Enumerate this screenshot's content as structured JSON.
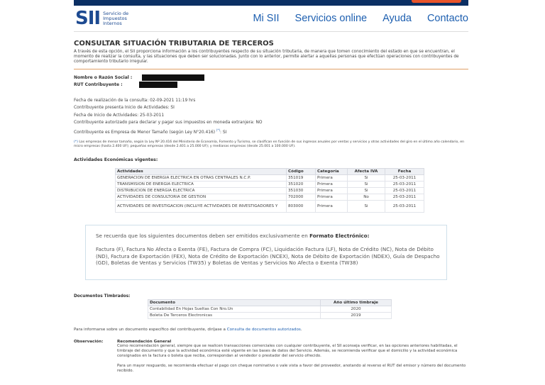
{
  "header": {
    "logo_mark": "SII",
    "logo_text": [
      "Servicio de",
      "Impuestos",
      "Internos"
    ],
    "nav": [
      "Mi SII",
      "Servicios online",
      "Ayuda",
      "Contacto"
    ]
  },
  "page": {
    "title": "CONSULTAR SITUACIÓN TRIBUTARIA DE TERCEROS",
    "intro": "A través de esta opción, el SII proporciona información a los contribuyentes respecto de su situación tributaria, de manera que tomen conocimiento del estado en que se encuentran, el momento de realizar la consulta, y las situaciones que deben ser solucionadas. Junto con lo anterior, permite alertar a aquellas personas que efectúan operaciones con contribuyentes de comportamiento tributario irregular."
  },
  "taxpayer": {
    "name_label": "Nombre o Razón Social :",
    "rut_label": "RUT Contribuyente :"
  },
  "info": {
    "fecha_consulta": "Fecha de realización de la consulta: 02-09-2021 11:19 hrs",
    "inicio_actividades": "Contribuyente presenta Inicio de Actividades: SI",
    "fecha_inicio": "Fecha de Inicio de Actividades: 25-03-2011",
    "moneda_extranjera": "Contribuyente autorizado para declarar y pagar sus impuestos en moneda extranjera: NO",
    "menor_tamano": "Contribuyente es Empresa de Menor Tamaño (según Ley N°20.416)",
    "menor_tamano_ref": "(*)",
    "menor_tamano_value": ": SI"
  },
  "note": {
    "mark": "(*)",
    "text": "Las empresas de menor tamaño, según la Ley Nº 20.416 del Ministerio de Economía, Fomento y Turismo, se clasifican en función de sus ingresos anuales por ventas y servicios y otras actividades del giro en el último año calendario, en micro empresas (hasta 2.400 UF); pequeñas empresas (desde 2.401 a 25.000 UF); y medianas empresas (desde 25.001 a 100.000 UF)."
  },
  "activities": {
    "section_title": "Actividades Económicas vigentes:",
    "columns": [
      "Actividades",
      "Código",
      "Categoría",
      "Afecta IVA",
      "Fecha"
    ],
    "rows": [
      [
        "GENERACION DE ENERGIA ELECTRICA EN OTRAS CENTRALES N.C.P.",
        "351019",
        "Primera",
        "Si",
        "25-03-2011"
      ],
      [
        "TRANSMISION DE ENERGIA ELECTRICA",
        "351020",
        "Primera",
        "Si",
        "25-03-2011"
      ],
      [
        "DISTRIBUCION DE ENERGIA ELECTRICA",
        "351030",
        "Primera",
        "Si",
        "25-03-2011"
      ],
      [
        "ACTIVIDADES DE CONSULTORIA DE GESTION",
        "702000",
        "Primera",
        "No",
        "25-03-2011"
      ],
      [
        "ACTIVIDADES DE INVESTIGACION (INCLUYE ACTIVIDADES DE INVESTIGADORES Y",
        "803000",
        "Primera",
        "Si",
        "25-03-2011"
      ]
    ]
  },
  "electronic": {
    "lead": "Se recuerda que los siguientes documentos deben ser emitidos exclusivamente en",
    "lead_bold": "Formato Electrónico:",
    "list": "Factura (F), Factura No Afecta o Exenta (FE), Factura de Compra (FC), Liquidación Factura (LF), Nota de Crédito (NC), Nota de Débito (ND), Factura de Exportación (FEX), Nota de Crédito de Exportación (NCEX), Nota de Débito de Exportación (NDEX), Guía de Despacho (GD), Boletas de Ventas y Servicios (TW35) y Boletas de Ventas y Servicios No Afecta o Exenta (TW38)"
  },
  "stamped": {
    "section_title": "Documentos Timbrados:",
    "columns": [
      "Documento",
      "Año último timbraje"
    ],
    "rows": [
      [
        "Contabilidad En Hojas Sueltas Con Nro.Un",
        "2020"
      ],
      [
        "Boleta De Terceros Electronicas",
        "2019"
      ]
    ]
  },
  "specific_doc": {
    "text": "Para informarse sobre un documento específico del contribuyente, diríjase a",
    "link": "Consulta de documentos autorizados",
    "end": "."
  },
  "observation": {
    "label": "Observación:",
    "title": "Recomendación General",
    "p1": "Como recomendación general, siempre que se realicen transacciones comerciales con cualquier contribuyente, el SII aconseja verificar, en las opciones anteriores habilitadas, el timbraje del documento y que la actividad económica esté vigente en las bases de datos del Servicio. Además, se recomienda verificar que el domicilio y la actividad económica consignados en la factura o boleta que reciba, correspondan al vendedor o prestador del servicio ofrecido.",
    "p2": "Para un mayor resguardo, se recomienda efectuar el pago con cheque nominativo o vale vista a favor del proveedor, anotando al reverso el RUT del emisor y número del documento recibido."
  }
}
